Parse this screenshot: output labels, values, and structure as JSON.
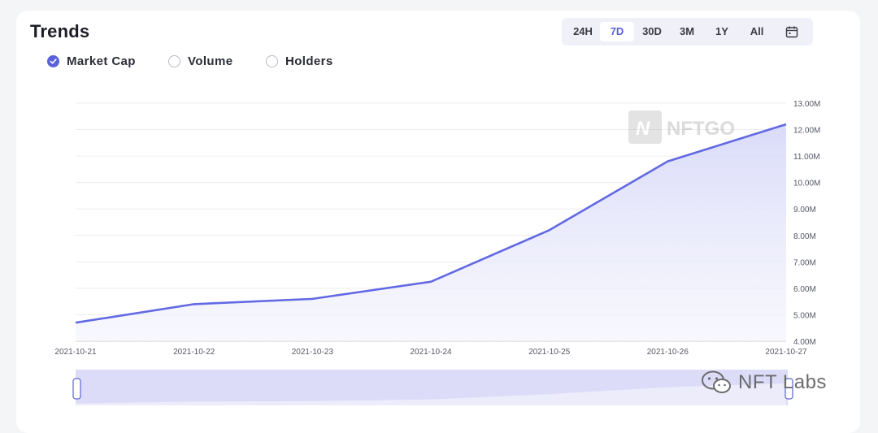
{
  "header": {
    "title": "Trends"
  },
  "range_selector": {
    "options": [
      "24H",
      "7D",
      "30D",
      "3M",
      "1Y",
      "All"
    ],
    "active": "7D",
    "calendar_icon": "calendar-icon"
  },
  "metrics": [
    {
      "label": "Market Cap",
      "checked": true
    },
    {
      "label": "Volume",
      "checked": false
    },
    {
      "label": "Holders",
      "checked": false
    }
  ],
  "watermark": {
    "text": "NFTGO",
    "icon": "nftgo-logo-icon"
  },
  "branding": {
    "text": "NFT Labs",
    "icon": "wechat-icon"
  },
  "colors": {
    "accent": "#5b62d9",
    "line": "#6269e3",
    "area": "#e4e5fa",
    "navigator": "#dcdcf8"
  },
  "chart_data": {
    "type": "area",
    "x": [
      "2021-10-21",
      "2021-10-22",
      "2021-10-23",
      "2021-10-24",
      "2021-10-25",
      "2021-10-26",
      "2021-10-27"
    ],
    "series": [
      {
        "values": [
          4.7,
          5.4,
          5.6,
          6.25,
          8.2,
          10.8,
          12.2
        ]
      }
    ],
    "ylim": [
      4,
      13
    ],
    "yticks": [
      "4.00M",
      "5.00M",
      "6.00M",
      "7.00M",
      "8.00M",
      "9.00M",
      "10.00M",
      "11.00M",
      "12.00M",
      "13.00M"
    ],
    "yaxis_position": "right",
    "grid": true
  }
}
